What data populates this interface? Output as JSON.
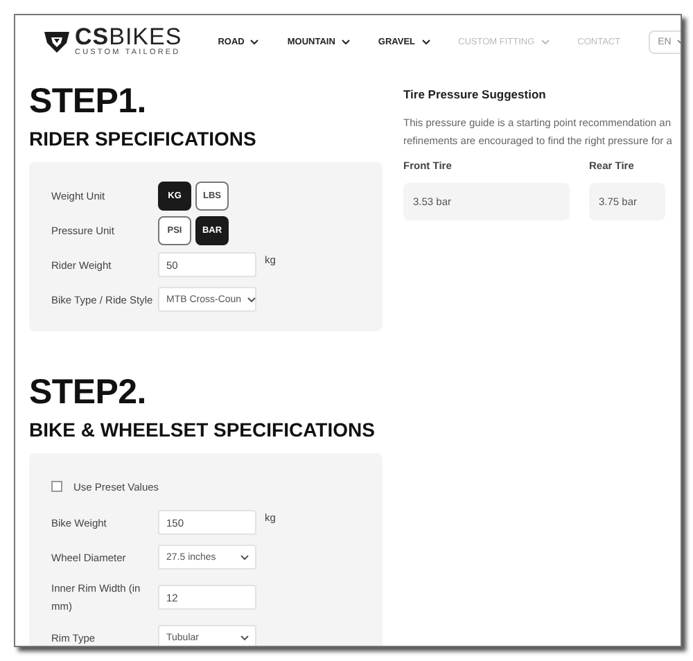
{
  "header": {
    "logo": {
      "brand": "**CS**BIKES",
      "tagline": "CUSTOM TAILORED"
    },
    "nav": [
      {
        "label": "ROAD",
        "caret": true,
        "disabled": false
      },
      {
        "label": "MOUNTAIN",
        "caret": true,
        "disabled": false
      },
      {
        "label": "GRAVEL",
        "caret": true,
        "disabled": false
      },
      {
        "label": "CUSTOM FITTING",
        "caret": true,
        "disabled": true
      },
      {
        "label": "CONTACT",
        "caret": false,
        "disabled": true
      }
    ],
    "language": "EN"
  },
  "steps": [
    {
      "step": "STEP1.",
      "title": "RIDER SPECIFICATIONS",
      "fields": [
        {
          "kind": "toggle",
          "label": "Weight Unit",
          "options": [
            {
              "label": "KG",
              "selected": true
            },
            {
              "label": "LBS",
              "selected": false
            }
          ]
        },
        {
          "kind": "toggle",
          "label": "Pressure Unit",
          "options": [
            {
              "label": "PSI",
              "selected": false
            },
            {
              "label": "BAR",
              "selected": true
            }
          ]
        },
        {
          "kind": "input",
          "label": "Rider Weight",
          "value": "50",
          "unit": "kg"
        },
        {
          "kind": "select",
          "label": "Bike Type / Ride Style",
          "value": "MTB Cross-Coun"
        }
      ]
    },
    {
      "step": "STEP2.",
      "title": "BIKE & WHEELSET SPECIFICATIONS",
      "fields": [
        {
          "kind": "checkbox",
          "label": "Use Preset Values",
          "checked": false
        },
        {
          "kind": "input",
          "label": "Bike Weight",
          "value": "150",
          "unit": "kg"
        },
        {
          "kind": "select",
          "label": "Wheel Diameter",
          "value": "27.5 inches"
        },
        {
          "kind": "input",
          "label": "Inner Rim Width (in mm)",
          "value": "12"
        },
        {
          "kind": "select",
          "label": "Rim Type",
          "value": "Tubular"
        }
      ]
    }
  ],
  "suggestion": {
    "title": "Tire Pressure Suggestion",
    "text_lines": [
      "This pressure guide is a starting point recommendation an",
      "refinements are encouraged to find the right pressure for a"
    ],
    "tires": [
      {
        "label": "Front Tire",
        "value": "3.53 bar"
      },
      {
        "label": "Rear Tire",
        "value": "3.75 bar"
      }
    ]
  }
}
